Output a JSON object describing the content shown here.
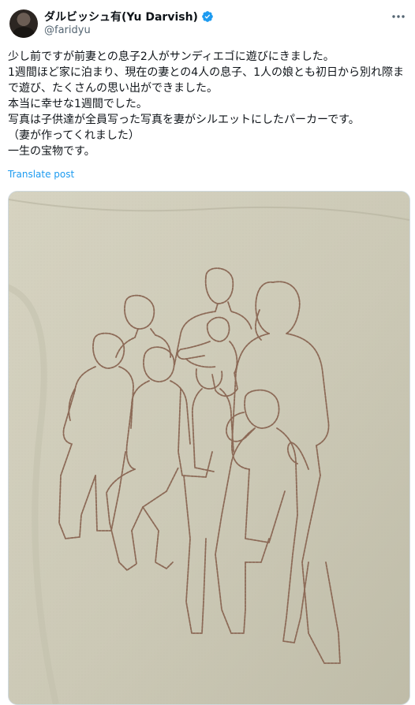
{
  "author": {
    "display_name": "ダルビッシュ有(Yu Darvish)",
    "handle": "@faridyu",
    "verified": true,
    "avatar_icon": "profile-avatar",
    "verified_icon": "verified-badge-icon",
    "verified_color": "#1d9bf0"
  },
  "menu": {
    "icon": "more-dots-icon"
  },
  "post": {
    "lines": [
      "少し前ですが前妻との息子2人がサンディエゴに遊びにきました。",
      "1週間ほど家に泊まり、現在の妻との4人の息子、1人の娘とも初日から別れ際まで遊び、たくさんの思い出ができました。",
      "本当に幸せな1週間でした。",
      "写真は子供達が全員写った写真を妻がシルエットにしたパーカーです。",
      "（妻が作ってくれました）",
      "一生の宝物です。"
    ],
    "translate_label": "Translate post"
  },
  "colors": {
    "link": "#1d9bf0",
    "text": "#0f1419",
    "secondary_text": "#536471",
    "fabric": "#ccc9b6",
    "embroidery": "#8c6a57"
  }
}
